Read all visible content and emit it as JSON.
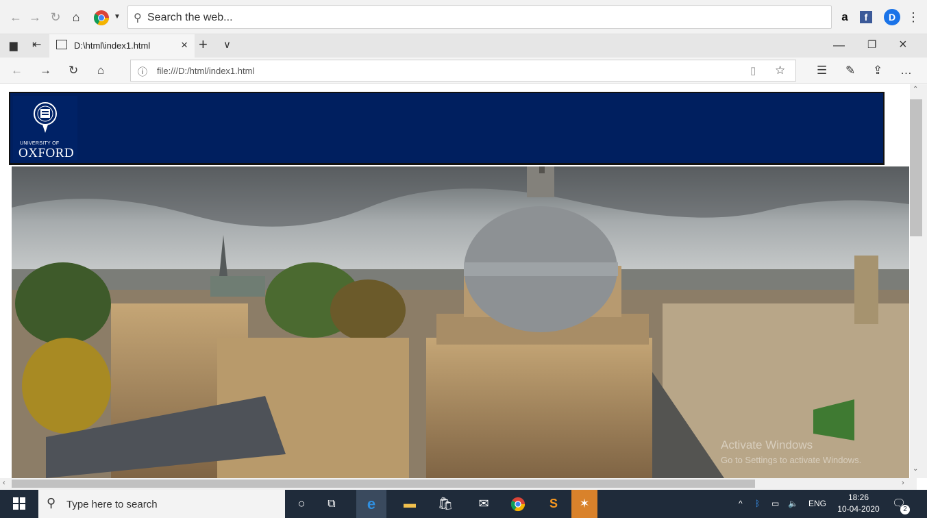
{
  "search_bar": {
    "placeholder": "Search the web..."
  },
  "browser": {
    "tab_title": "D:\\html\\index1.html",
    "url": "file:///D:/html/index1.html"
  },
  "page": {
    "logo_university": "UNIVERSITY OF",
    "logo_name": "OXFORD"
  },
  "watermark": {
    "line1": "Activate Windows",
    "line2": "Go to Settings to activate Windows."
  },
  "taskbar": {
    "search_placeholder": "Type here to search",
    "language": "ENG",
    "time": "18:26",
    "date": "10-04-2020",
    "notification_count": "2"
  },
  "colors": {
    "header_bg": "#001f5f",
    "taskbar_bg": "#1f2b3a"
  }
}
